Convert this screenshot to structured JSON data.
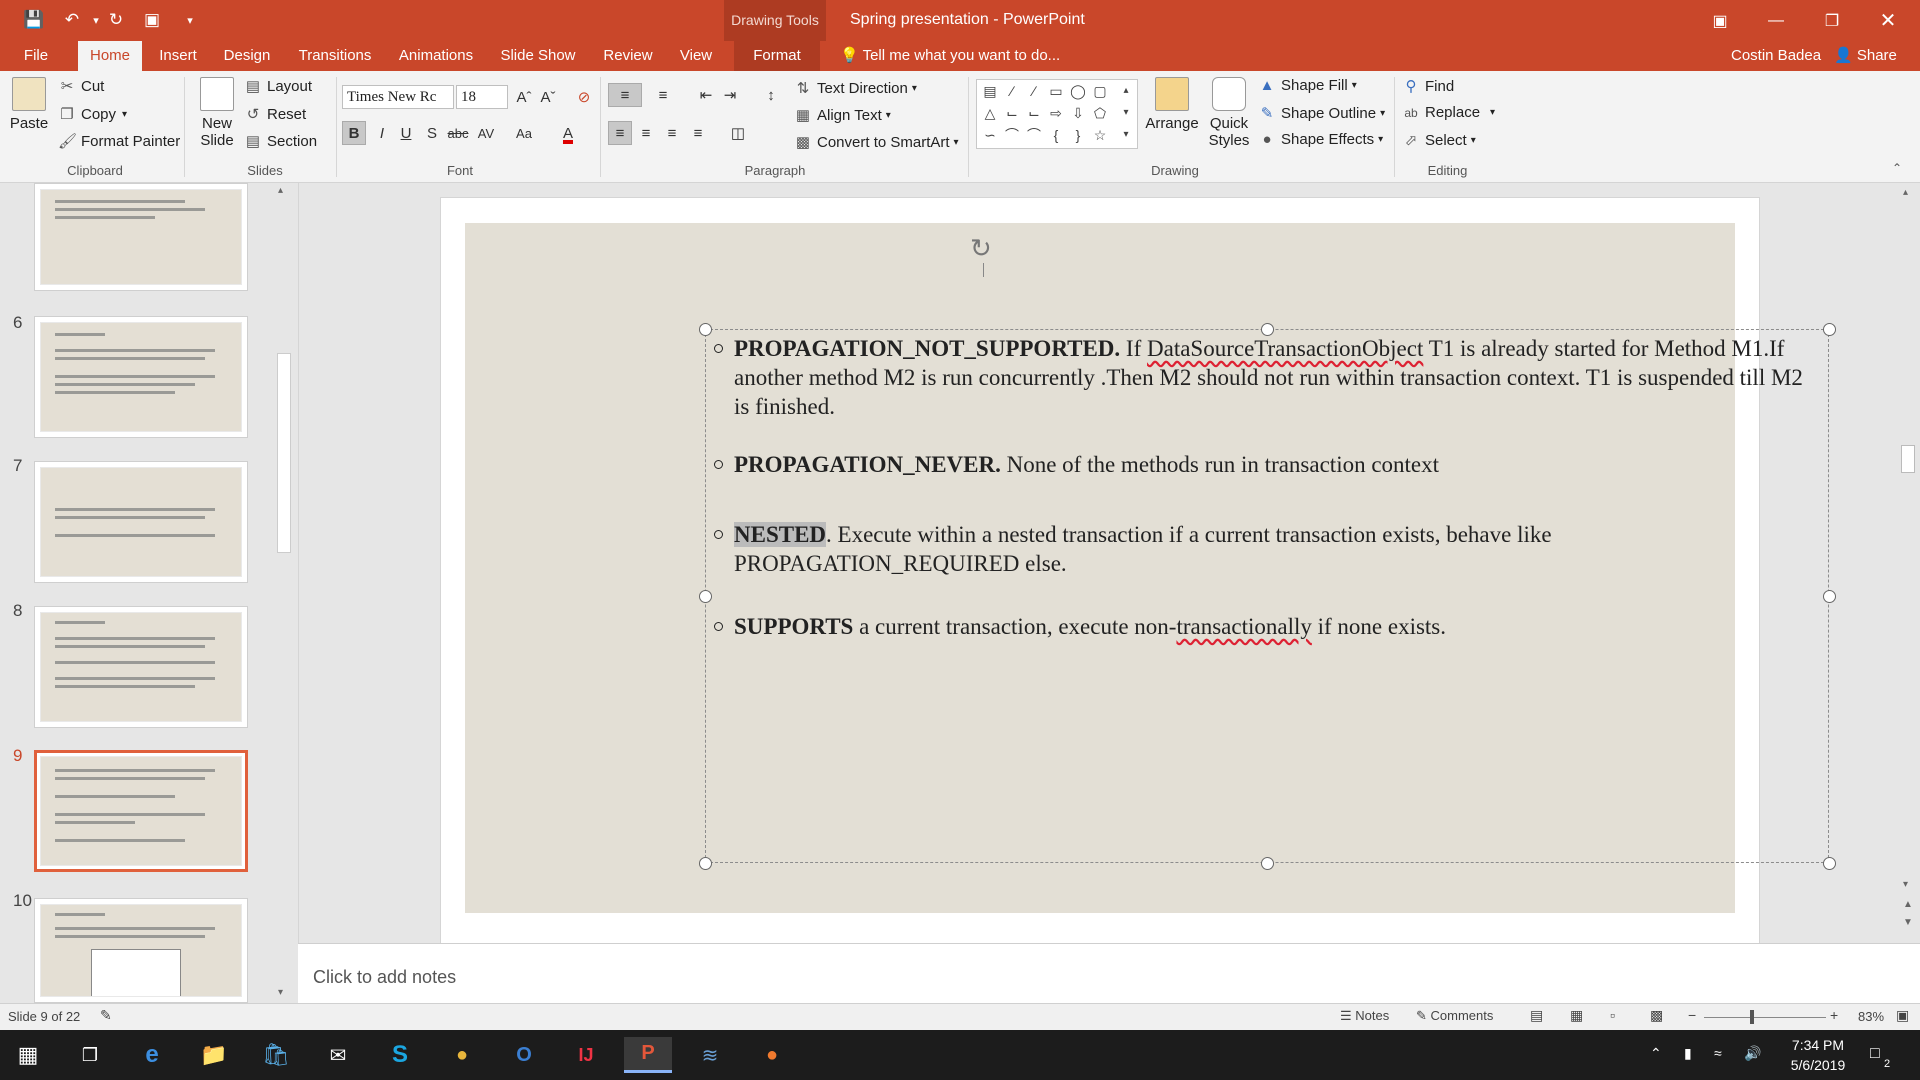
{
  "window": {
    "context_tab_group": "Drawing Tools",
    "title": "Spring presentation - PowerPoint"
  },
  "tabs": [
    "File",
    "Home",
    "Insert",
    "Design",
    "Transitions",
    "Animations",
    "Slide Show",
    "Review",
    "View",
    "Format"
  ],
  "active_tab": "Home",
  "tell_me": "Tell me what you want to do...",
  "user": "Costin Badea",
  "share": "Share",
  "ribbon": {
    "clipboard": {
      "paste": "Paste",
      "cut": "Cut",
      "copy": "Copy",
      "format_painter": "Format Painter",
      "label": "Clipboard"
    },
    "slides": {
      "new_slide_1": "New",
      "new_slide_2": "Slide",
      "layout": "Layout",
      "reset": "Reset",
      "section": "Section",
      "label": "Slides"
    },
    "font": {
      "family": "Times New Rc",
      "size": "18",
      "label": "Font"
    },
    "paragraph": {
      "text_direction": "Text Direction",
      "align_text": "Align Text",
      "smartart": "Convert to SmartArt",
      "label": "Paragraph"
    },
    "drawing": {
      "arrange": "Arrange",
      "quick_styles_1": "Quick",
      "quick_styles_2": "Styles",
      "shape_fill": "Shape Fill",
      "shape_outline": "Shape Outline",
      "shape_effects": "Shape Effects",
      "label": "Drawing"
    },
    "editing": {
      "find": "Find",
      "replace": "Replace",
      "select": "Select",
      "label": "Editing"
    }
  },
  "thumbnails": [
    {
      "num": "6"
    },
    {
      "num": "7"
    },
    {
      "num": "8"
    },
    {
      "num": "9"
    },
    {
      "num": "10"
    }
  ],
  "slide": {
    "bullets": [
      {
        "bold": "PROPAGATION_NOT_SUPPORTED.",
        "pre": " If ",
        "squiggle": "DataSourceTransactionObject",
        "rest": " T1 is already started for Method M1.If another method M2 is run concurrently .Then M2 should not run within transaction context. T1 is suspended till M2 is finished."
      },
      {
        "bold": "PROPAGATION_NEVER.",
        "rest": " None of the methods run in transaction context"
      },
      {
        "bold": "NESTED",
        "rest": ". Execute within a nested transaction if a current transaction exists, behave like PROPAGATION_REQUIRED else."
      },
      {
        "bold": "SUPPORTS",
        "pre": " a current transaction, execute non-",
        "squiggle": "transactionally",
        "rest": " if none exists."
      }
    ]
  },
  "notes_placeholder": "Click to add notes",
  "status": {
    "slide_info": "Slide 9 of 22",
    "notes": "Notes",
    "comments": "Comments",
    "zoom": "83%"
  },
  "clock": {
    "time": "7:34 PM",
    "date": "5/6/2019"
  },
  "notification_count": "2"
}
